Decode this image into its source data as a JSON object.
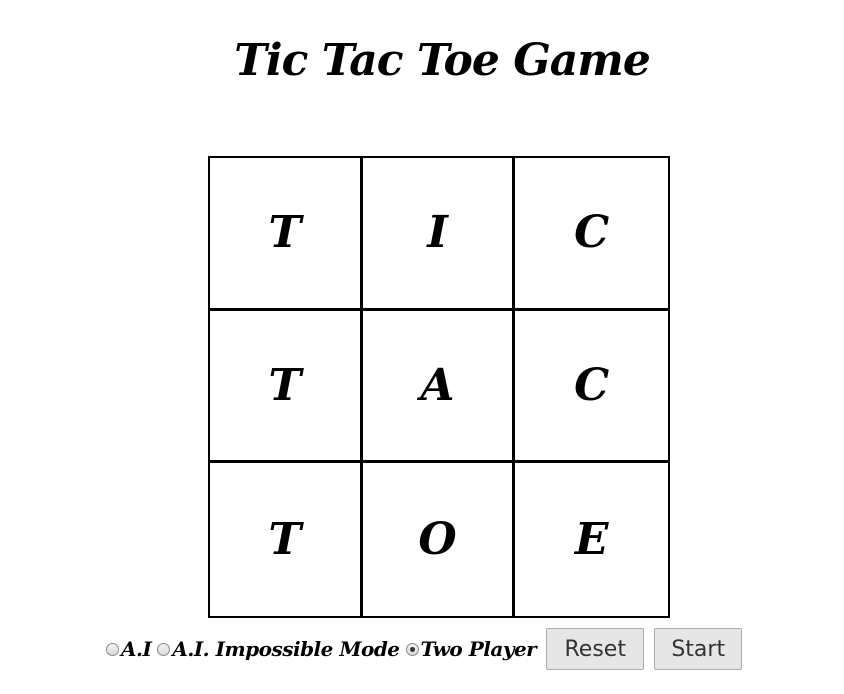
{
  "title": "Tic Tac Toe Game",
  "board": {
    "cells": [
      "T",
      "I",
      "C",
      "T",
      "A",
      "C",
      "T",
      "O",
      "E"
    ]
  },
  "modes": [
    {
      "label": "A.I",
      "selected": false
    },
    {
      "label": "A.I. Impossible Mode",
      "selected": false
    },
    {
      "label": "Two Player",
      "selected": true
    }
  ],
  "buttons": {
    "reset": "Reset",
    "start": "Start"
  }
}
